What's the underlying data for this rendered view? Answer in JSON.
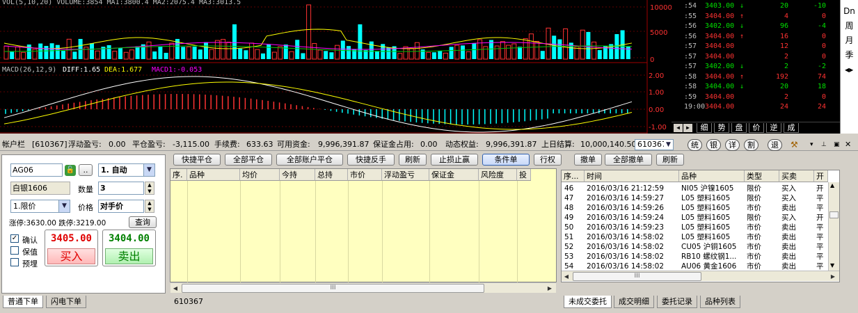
{
  "volume_panel": {
    "header": "VOL(5,10,20) VOLUME:3854 MA1:3800.4 MA2:2075.4 MA3:3013.5",
    "axis": [
      "10000",
      "5000",
      "0"
    ]
  },
  "macd_panel": {
    "label": "MACD(26,12,9)",
    "diff": "DIFF:1.65",
    "dea": "DEA:1.677",
    "macd1": "MACD1:-0.053",
    "axis": [
      "2.00",
      "1.00",
      "0.00",
      "-1.00"
    ]
  },
  "colors": {
    "cyan": "#00ffff",
    "red": "#ff3232",
    "green": "#00e000",
    "yellow": "#ffff00",
    "white": "#ffffff",
    "magenta": "#ff00ff",
    "bg": "#000000"
  },
  "ticks": [
    {
      "time": ":54",
      "price": "3403.00",
      "dir": "down",
      "vol": "20",
      "chg": "-10",
      "color": "#00e000"
    },
    {
      "time": ":55",
      "price": "3404.00",
      "dir": "up",
      "vol": "4",
      "chg": "0",
      "color": "#ff3232"
    },
    {
      "time": ":56",
      "price": "3402.00",
      "dir": "down",
      "vol": "96",
      "chg": "-4",
      "color": "#00e000"
    },
    {
      "time": ":56",
      "price": "3404.00",
      "dir": "up",
      "vol": "16",
      "chg": "0",
      "color": "#ff3232"
    },
    {
      "time": ":57",
      "price": "3404.00",
      "dir": "",
      "vol": "12",
      "chg": "0",
      "color": "#ff3232"
    },
    {
      "time": ":57",
      "price": "3404.00",
      "dir": "",
      "vol": "2",
      "chg": "0",
      "color": "#ff3232"
    },
    {
      "time": ":57",
      "price": "3402.00",
      "dir": "down",
      "vol": "2",
      "chg": "-2",
      "color": "#00e000"
    },
    {
      "time": ":58",
      "price": "3404.00",
      "dir": "up",
      "vol": "192",
      "chg": "74",
      "color": "#ff3232"
    },
    {
      "time": ":58",
      "price": "3404.00",
      "dir": "down",
      "vol": "20",
      "chg": "18",
      "color": "#00e000"
    },
    {
      "time": ":59",
      "price": "3404.00",
      "dir": "",
      "vol": "2",
      "chg": "0",
      "color": "#ff3232"
    },
    {
      "time": "19:00",
      "price": "3404.00",
      "dir": "",
      "vol": "24",
      "chg": "24",
      "color": "#ff3232"
    }
  ],
  "tick_tabs": [
    "细",
    "势",
    "盘",
    "价",
    "逆",
    "成"
  ],
  "side_tabs": [
    "Dn",
    "周",
    "月",
    "季"
  ],
  "account_bar": {
    "label": "帐户栏",
    "account": "[610367]",
    "float_pl_label": "浮动盈亏:",
    "float_pl": "0.00",
    "close_pl_label": "平仓盈亏:",
    "close_pl": "-3,115.00",
    "fee_label": "手续费:",
    "fee": "633.63",
    "avail_label": "可用资金:",
    "avail": "9,996,391.87",
    "margin_label": "保证金占用:",
    "margin": "0.00",
    "equity_label": "动态权益:",
    "equity": "9,996,391.87",
    "settle_label": "上日结算:",
    "settle": "10,000,140.50",
    "account_select": "610367",
    "circle_buttons": [
      "统",
      "银",
      "详",
      "割",
      "退"
    ]
  },
  "order": {
    "code": "AG06",
    "dots": "..",
    "mode": "1. 自动",
    "name": "白银1606",
    "qty_label": "数量",
    "qty": "3",
    "price_type": "1.限价",
    "price_label": "价格",
    "price": "对手价",
    "limit_text": "涨停:3630.00 跌停:3219.00",
    "query": "查询",
    "confirm": "确认",
    "keep": "保值",
    "preset": "预埋",
    "buy_price": "3405.00",
    "buy_label": "买入",
    "sell_price": "3404.00",
    "sell_label": "卖出"
  },
  "toolbar": [
    "快捷平仓",
    "全部平仓",
    "全部账户平仓",
    "快捷反手",
    "刷新",
    "止损止赢",
    "条件单",
    "行权",
    "撤单",
    "全部撤单",
    "刷新"
  ],
  "position_headers": [
    "序.",
    "品种",
    "均价",
    "今持",
    "总持",
    "市价",
    "浮动盈亏",
    "保证金",
    "风险度",
    "投"
  ],
  "position_footer": "610367",
  "history_headers": [
    "序...",
    "时间",
    "品种",
    "类型",
    "买卖",
    "开"
  ],
  "history_rows": [
    {
      "no": "46",
      "time": "2016/03/16 21:12:59",
      "name": "NI05 沪镍1605",
      "type": "限价",
      "side": "买入",
      "oc": "开"
    },
    {
      "no": "47",
      "time": "2016/03/16 14:59:27",
      "name": "L05 塑料1605",
      "type": "限价",
      "side": "买入",
      "oc": "平"
    },
    {
      "no": "48",
      "time": "2016/03/16 14:59:26",
      "name": "L05 塑料1605",
      "type": "市价",
      "side": "卖出",
      "oc": "平"
    },
    {
      "no": "49",
      "time": "2016/03/16 14:59:24",
      "name": "L05 塑料1605",
      "type": "限价",
      "side": "买入",
      "oc": "开"
    },
    {
      "no": "50",
      "time": "2016/03/16 14:59:23",
      "name": "L05 塑料1605",
      "type": "市价",
      "side": "卖出",
      "oc": "平"
    },
    {
      "no": "51",
      "time": "2016/03/16 14:58:02",
      "name": "L05 塑料1605",
      "type": "市价",
      "side": "卖出",
      "oc": "平"
    },
    {
      "no": "52",
      "time": "2016/03/16 14:58:02",
      "name": "CU05 沪铜1605",
      "type": "市价",
      "side": "卖出",
      "oc": "平"
    },
    {
      "no": "53",
      "time": "2016/03/16 14:58:02",
      "name": "RB10 螺纹钢1...",
      "type": "市价",
      "side": "卖出",
      "oc": "平"
    },
    {
      "no": "54",
      "time": "2016/03/16 14:58:02",
      "name": "AU06 黄金1606",
      "type": "市价",
      "side": "卖出",
      "oc": "平"
    },
    {
      "no": "55",
      "time": "2016/03/16 14:57:59",
      "name": "L05 塑料1605",
      "type": "市价",
      "side": "卖出",
      "oc": "平"
    }
  ],
  "bottom_tabs_left": [
    "普通下单",
    "闪电下单"
  ],
  "bottom_tabs_right": [
    "未成交委托",
    "成交明细",
    "委托记录",
    "品种列表"
  ]
}
